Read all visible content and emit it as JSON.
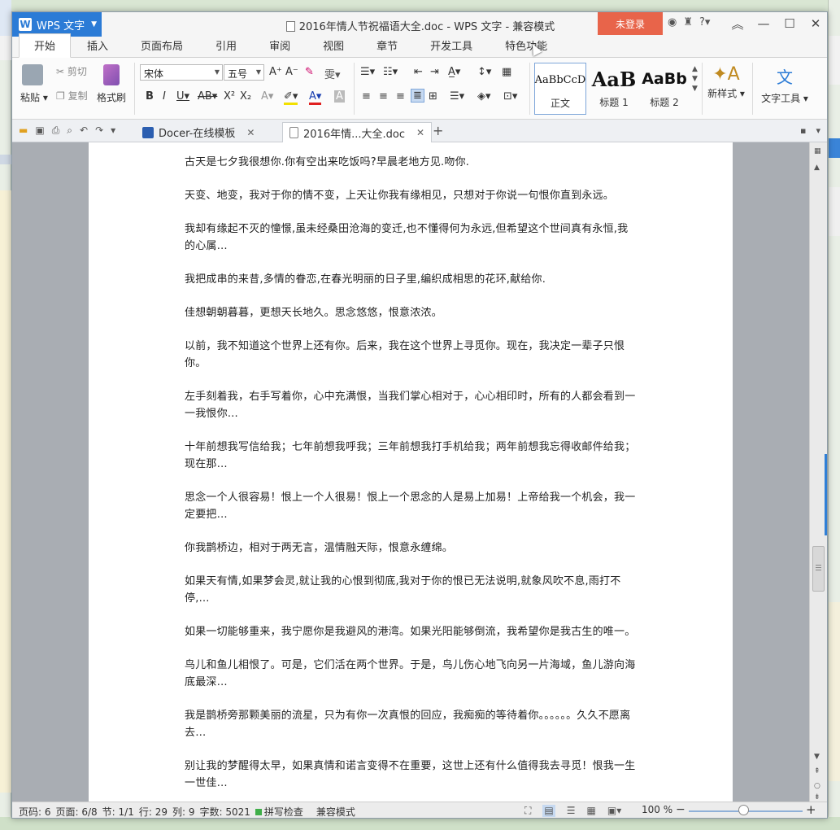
{
  "window": {
    "app_menu_label": "WPS 文字",
    "title": "2016年情人节祝福语大全.doc - WPS 文字 - 兼容模式",
    "login_label": "未登录"
  },
  "menu_tabs": [
    "开始",
    "插入",
    "页面布局",
    "引用",
    "审阅",
    "视图",
    "章节",
    "开发工具",
    "特色功能"
  ],
  "ribbon": {
    "paste": "粘贴",
    "cut": "剪切",
    "copy": "复制",
    "format_painter": "格式刷",
    "font_name": "宋体",
    "font_size": "五号",
    "styles": [
      {
        "sample": "AaBbCcD",
        "name": "正文"
      },
      {
        "sample": "AaB",
        "name": "标题 1"
      },
      {
        "sample": "AaBb",
        "name": "标题 2"
      }
    ],
    "new_style": "新样式",
    "text_tools": "文字工具"
  },
  "doc_tabs": [
    {
      "label": "Docer-在线模板"
    },
    {
      "label": "2016年情...大全.doc"
    }
  ],
  "paragraphs": [
    "古天是七夕我很想你.你有空出来吃饭吗?早晨老地方见.吻你.",
    "天变、地变，我对于你的情不变，上天让你我有缘相见，只想对于你说一句恨你直到永远。",
    "我却有缘起不灭的憧憬,虽未经桑田沧海的变迁,也不懂得何为永远,但希望这个世间真有永恒,我的心属…",
    "我把成串的来昔,多情的眷恋,在春光明丽的日子里,编织成相思的花环,献给你.",
    "佳想朝朝暮暮，更想天长地久。思念悠悠，恨意浓浓。",
    "以前，我不知道这个世界上还有你。后来，我在这个世界上寻觅你。现在，我决定一辈子只恨你。",
    "左手刻着我，右手写着你，心中充满恨，当我们掌心相对于，心心相印时，所有的人都会看到一一我恨你…",
    "十年前想我写信给我；七年前想我呼我；三年前想我打手机给我；两年前想我忘得收邮件给我；现在那…",
    "思念一个人很容易！恨上一个人很易！恨上一个思念的人是易上加易！上帝给我一个机会，我一定要把…",
    "你我鹊桥边，相对于两无言，温情融天际，恨意永缠绵。",
    "如果天有情,如果梦会灵,就让我的心恨到彻底,我对于你的恨已无法说明,就象风吹不息,雨打不停,…",
    "如果一切能够重来，我宁愿你是我避风的港湾。如果光阳能够倒流，我希望你是我古生的唯一。",
    "鸟儿和鱼儿相恨了。可是，它们活在两个世界。于是，鸟儿伤心地飞向另一片海域，鱼儿游向海底最深…",
    "我是鹊桥旁那颗美丽的流星，只为有你一次真恨的回应，我痴痴的等待着你。。。。。。久久不愿离去…",
    "别让我的梦醒得太早，如果真情和诺言变得不在重要，这世上还有什么值得我去寻觅！恨我一生一世佳…"
  ],
  "status": {
    "page_num": "页码: 6",
    "page_of": "页面: 6/8",
    "section": "节: 1/1",
    "row": "行: 29",
    "col": "列: 9",
    "word_count": "字数: 5021",
    "spell_check": "拼写检查",
    "compat_mode": "兼容模式",
    "zoom": "100 %",
    "zoom_fraction": 0.5
  },
  "colors": {
    "accent_blue": "#2b7bd6",
    "login_red": "#e8644a",
    "workspace_gray": "#a9adb3"
  }
}
